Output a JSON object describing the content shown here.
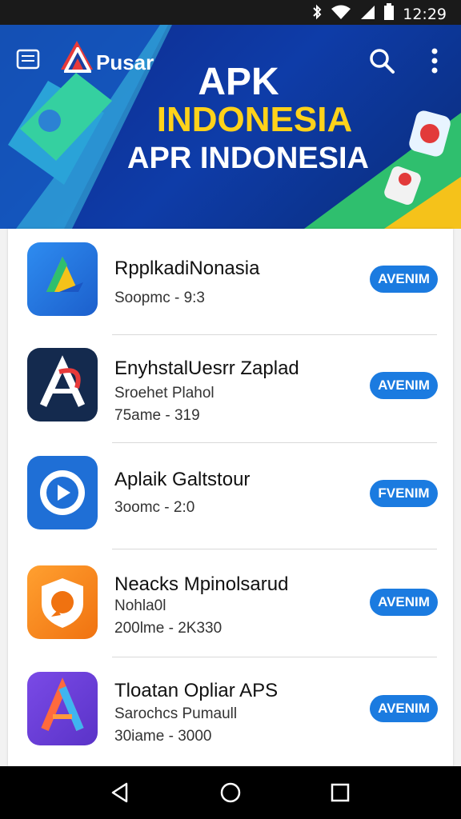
{
  "status_bar": {
    "time": "12:29"
  },
  "header": {
    "brand": "Pusar"
  },
  "banner": {
    "line1": "APK",
    "line2": "INDONESIA",
    "line3": "APR INDONESIA"
  },
  "apps": [
    {
      "name": "RpplkadiNonasia",
      "meta1": "Soopmc - 9:3",
      "meta2": "",
      "button": "AVENIM",
      "icon": "google-drive-style-icon",
      "color": "#2b7fe0"
    },
    {
      "name": "EnyhstalUesrr Zaplad",
      "meta1": "Sroehet Plahol",
      "meta2": "75ame - 319",
      "button": "AVENIM",
      "icon": "letter-a-logo-icon",
      "color": "#142a4e"
    },
    {
      "name": "Aplaik Galtstour",
      "meta1": "3oomc - 2:0",
      "meta2": "",
      "button": "FVENIM",
      "icon": "play-circle-icon",
      "color": "#1f6fd6"
    },
    {
      "name": "Neacks Mpinolsarud",
      "meta1": "Nohla0l",
      "meta2": "200lme - 2K330",
      "button": "AVENIM",
      "icon": "shield-chat-icon",
      "color": "#f58a1f"
    },
    {
      "name": "Tloatan Opliar APS",
      "meta1": "Sarochcs Pumaull",
      "meta2": "30iame - 3000",
      "button": "AVENIM",
      "icon": "letter-a-logo-icon",
      "color": "#6a3fd6"
    }
  ]
}
